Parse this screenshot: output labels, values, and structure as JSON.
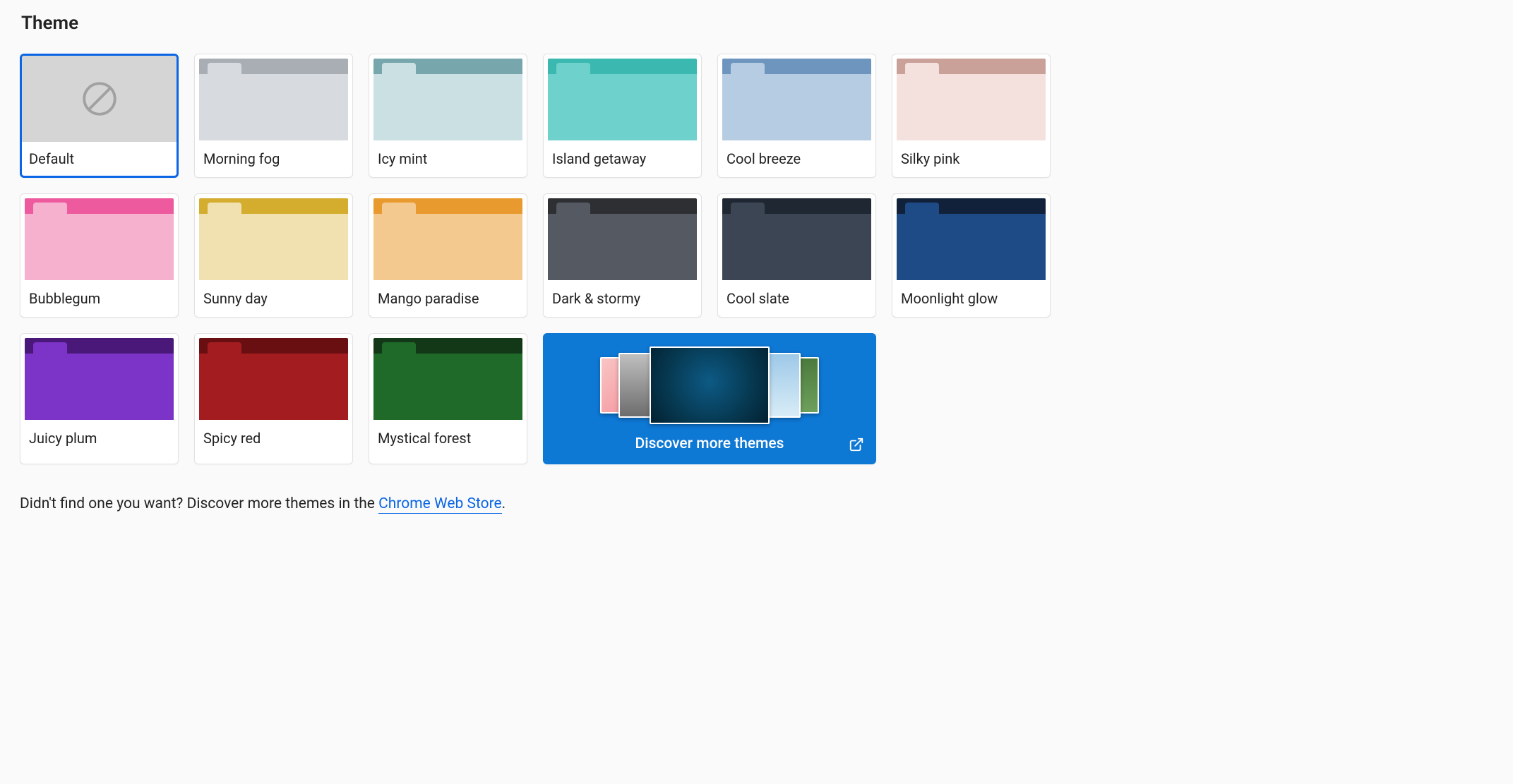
{
  "heading": "Theme",
  "selected_index": 0,
  "themes": [
    {
      "label": "Default",
      "frame": "#d5d5d5",
      "tab": null,
      "body": null,
      "default": true
    },
    {
      "label": "Morning fog",
      "frame": "#a9aeb4",
      "tab": "#d7dadf",
      "body": "#d7dadf"
    },
    {
      "label": "Icy mint",
      "frame": "#77a7ad",
      "tab": "#cbe0e3",
      "body": "#cbe0e3"
    },
    {
      "label": "Island getaway",
      "frame": "#3bb8b0",
      "tab": "#6fd1cc",
      "body": "#6fd1cc"
    },
    {
      "label": "Cool breeze",
      "frame": "#6e95bd",
      "tab": "#b6cce2",
      "body": "#b6cce2"
    },
    {
      "label": "Silky pink",
      "frame": "#caa199",
      "tab": "#f4e1de",
      "body": "#f4e1de"
    },
    {
      "label": "Bubblegum",
      "frame": "#ed5a9e",
      "tab": "#f6b1cf",
      "body": "#f6b1cf"
    },
    {
      "label": "Sunny day",
      "frame": "#d4ac2e",
      "tab": "#f1e0b0",
      "body": "#f1e0b0"
    },
    {
      "label": "Mango paradise",
      "frame": "#e99a2e",
      "tab": "#f3c990",
      "body": "#f3c990"
    },
    {
      "label": "Dark & stormy",
      "frame": "#2d2f33",
      "tab": "#555961",
      "body": "#555961"
    },
    {
      "label": "Cool slate",
      "frame": "#1f2732",
      "tab": "#3b4554",
      "body": "#3b4554"
    },
    {
      "label": "Moonlight glow",
      "frame": "#12213a",
      "tab": "#1e4a86",
      "body": "#1e4a86"
    },
    {
      "label": "Juicy plum",
      "frame": "#4a1878",
      "tab": "#7c33c8",
      "body": "#7c33c8"
    },
    {
      "label": "Spicy red",
      "frame": "#6a0f11",
      "tab": "#a31d20",
      "body": "#a31d20"
    },
    {
      "label": "Mystical forest",
      "frame": "#133818",
      "tab": "#1f6a29",
      "body": "#1f6a29"
    }
  ],
  "discover_label": "Discover more themes",
  "footer_prefix": "Didn't find one you want? Discover more themes in the ",
  "footer_link": "Chrome Web Store",
  "footer_suffix": "."
}
